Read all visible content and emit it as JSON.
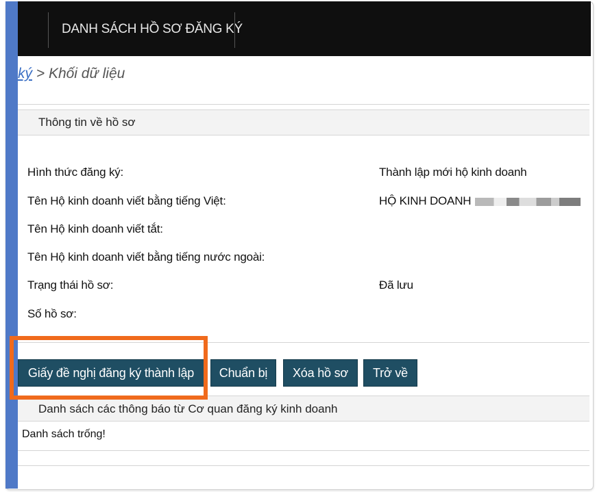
{
  "header": {
    "title": "DANH SÁCH HỒ SƠ ĐĂNG KÝ"
  },
  "breadcrumb": {
    "link": "ký",
    "separator": " > ",
    "current": "Khối dữ liệu"
  },
  "profile_section": {
    "heading": "Thông tin về hồ sơ",
    "rows": [
      {
        "label": "Hình thức đăng ký:",
        "value": "Thành lập mới hộ kinh doanh"
      },
      {
        "label": "Tên Hộ kinh doanh viết bằng tiếng Việt:",
        "value": "HỘ KINH DOANH"
      },
      {
        "label": "Tên Hộ kinh doanh viết tắt:",
        "value": ""
      },
      {
        "label": "Tên Hộ kinh doanh viết bằng tiếng nước ngoài:",
        "value": ""
      },
      {
        "label": "Trạng thái hồ sơ:",
        "value": "Đã lưu"
      },
      {
        "label": "Số hồ sơ:",
        "value": ""
      }
    ]
  },
  "actions": {
    "request_form": "Giấy đề nghị đăng ký thành lập",
    "prepare": "Chuẩn bị",
    "delete": "Xóa hồ sơ",
    "back": "Trở về"
  },
  "notices": {
    "heading": "Danh sách các thông báo từ Cơ quan đăng ký kinh doanh",
    "empty_text": "Danh sách trống!"
  },
  "colors": {
    "topbar": "#0f0f0f",
    "button": "#1f4e63",
    "highlight": "#f06a1c",
    "left_strip": "#4f79c7"
  }
}
